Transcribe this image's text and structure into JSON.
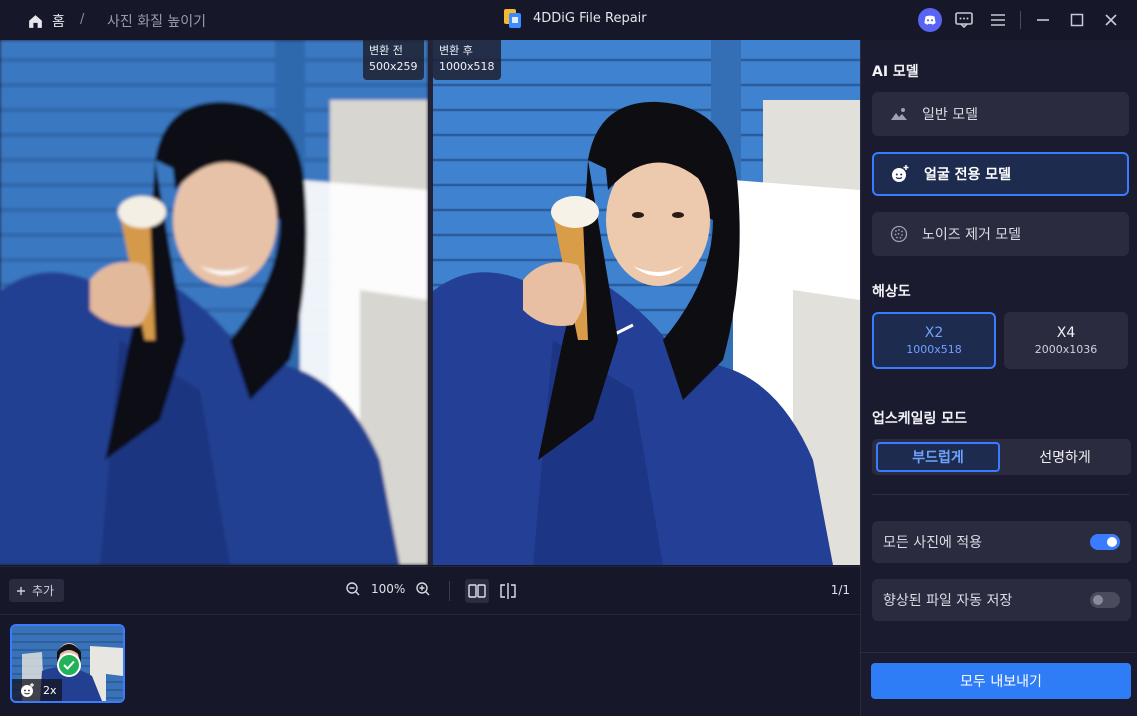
{
  "titlebar": {
    "home_label": "홈",
    "separator": "/",
    "breadcrumb": "사진 화질 높이기",
    "app_title": "4DDiG File Repair"
  },
  "preview": {
    "before_label": "변환 전",
    "before_size": "500x259",
    "after_label": "변환 후",
    "after_size": "1000x518"
  },
  "toolbar": {
    "add_label": "추가",
    "zoom_value": "100%",
    "page_indicator": "1/1"
  },
  "thumbnail": {
    "badge": "2x"
  },
  "panel": {
    "ai_model_title": "AI 모델",
    "models": [
      {
        "label": "일반 모델",
        "icon": "landscape-icon",
        "active": false
      },
      {
        "label": "얼굴 전용 모델",
        "icon": "face-sparkle-icon",
        "active": true
      },
      {
        "label": "노이즈 제거 모델",
        "icon": "noise-icon",
        "active": false
      }
    ],
    "resolution_title": "해상도",
    "resolutions": [
      {
        "label": "X2",
        "size": "1000x518",
        "active": true
      },
      {
        "label": "X4",
        "size": "2000x1036",
        "active": false
      }
    ],
    "upscale_title": "업스케일링 모드",
    "upscale_modes": [
      {
        "label": "부드럽게",
        "active": true
      },
      {
        "label": "선명하게",
        "active": false
      }
    ],
    "apply_all": {
      "label": "모든 사진에 적용",
      "on": true
    },
    "auto_save": {
      "label": "향상된 파일 자동 저장",
      "on": false
    },
    "export_label": "모두 내보내기"
  },
  "colors": {
    "accent": "#3a7bff",
    "background": "#161728",
    "panel": "#1a1b2e",
    "export": "#2e7cf6"
  }
}
